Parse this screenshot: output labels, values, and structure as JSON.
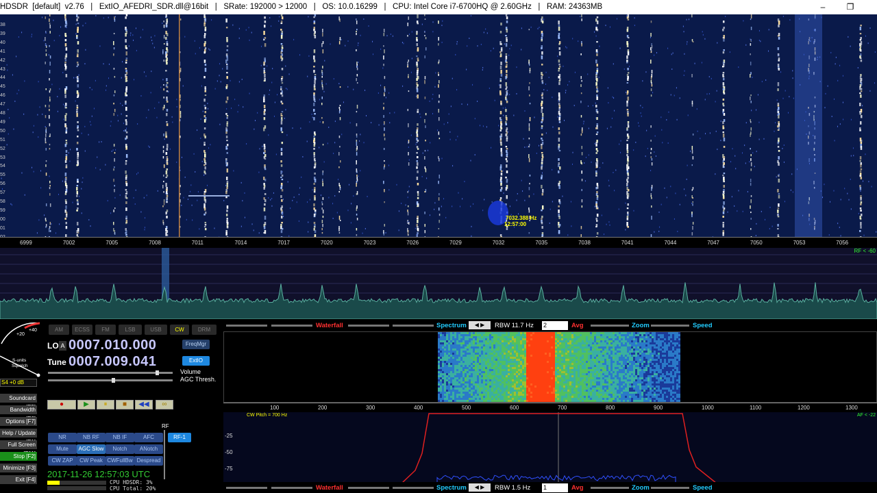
{
  "window": {
    "title": "HDSDR  [default]  v2.76   |   ExtIO_AFEDRI_SDR.dll@16bit   |   SRate: 192000 > 12000   |   OS: 10.0.16299   |   CPU: Intel Core i7-6700HQ @ 2.60GHz   |   RAM: 24363MB",
    "minimize": "–",
    "restore": "❐"
  },
  "waterfall": {
    "y_labels": [
      "38",
      "39",
      "40",
      "41",
      "42",
      "43",
      "44",
      "45",
      "46",
      "47",
      "48",
      "49",
      "50",
      "51",
      "52",
      "53",
      "54",
      "55",
      "56",
      "57",
      "58",
      "59",
      "00",
      "01",
      "02"
    ],
    "freq_ticks": [
      "6999",
      "7002",
      "7005",
      "7008",
      "7011",
      "7014",
      "7017",
      "7020",
      "7023",
      "7026",
      "7029",
      "7032",
      "7035",
      "7038",
      "7041",
      "7044",
      "7047",
      "7050",
      "7053",
      "7056"
    ],
    "cursor_freq": "7032.388 Hz",
    "cursor_time": "12:57:00"
  },
  "spectrum": {
    "rf_label": "RF < -60"
  },
  "modes": [
    {
      "label": "AM",
      "on": false
    },
    {
      "label": "ECSS",
      "on": false
    },
    {
      "label": "FM",
      "on": false
    },
    {
      "label": "LSB",
      "on": false
    },
    {
      "label": "USB",
      "on": false
    },
    {
      "label": "CW",
      "on": true
    },
    {
      "label": "DRM",
      "on": false
    }
  ],
  "meter": {
    "plus40": "+40",
    "plus20": "+20",
    "s_units": "S-units",
    "squelch": "Squelch",
    "reading": "S4 +0 dB"
  },
  "lo": {
    "label": "LO",
    "ab": "A",
    "value": "0007.010.000"
  },
  "tune": {
    "label": "Tune",
    "value": "0007.009.041"
  },
  "buttons": {
    "freqmgr": "FreqMgr",
    "extio": "ExtIO"
  },
  "sliders": {
    "volume": "Volume",
    "agc": "AGC Thresh."
  },
  "side_menu": [
    {
      "label": "Soundcard [F5]",
      "green": false
    },
    {
      "label": "Bandwidth [F6]",
      "green": false
    },
    {
      "label": "Options [F7]",
      "green": false
    },
    {
      "label": "Help / Update [F1]",
      "green": false
    },
    {
      "label": "Full Screen [F11]",
      "green": false
    },
    {
      "label": "Stop [F2]",
      "green": true
    },
    {
      "label": "Minimize [F3]",
      "green": false
    },
    {
      "label": "Exit [F4]",
      "green": false
    }
  ],
  "transport": {
    "record": "●",
    "play": "▶",
    "pause": "⏸",
    "stop": "■",
    "rewind": "◀◀",
    "loop": "∞"
  },
  "pads": [
    [
      "NR",
      "NB RF",
      "NB IF",
      "AFC"
    ],
    [
      "Mute",
      "AGC Slow",
      "Notch",
      "ANotch"
    ],
    [
      "CW ZAP",
      "CW Peak",
      "CWFullBw",
      "Despread"
    ]
  ],
  "rf_label": "RF",
  "rf_button": "RF-1",
  "datetime": "2017-11-26   12:57:03 UTC",
  "cpu": {
    "hdsdr": "CPU HDSDR:  3%",
    "total": "CPU Total: 20%"
  },
  "top_bar": {
    "waterfall": "Waterfall",
    "spectrum": "Spectrum",
    "rbw": "RBW 11.7 Hz",
    "avg_value": "2",
    "avg": "Avg",
    "zoom": "Zoom",
    "speed": "Speed"
  },
  "zoom_scale": [
    "100",
    "200",
    "300",
    "400",
    "500",
    "600",
    "700",
    "800",
    "900",
    "1000",
    "1100",
    "1200",
    "1300"
  ],
  "af": {
    "cw_pitch": "CW Pitch = 700 Hz",
    "af_label": "AF < -22",
    "y_labels": [
      "-25",
      "-50",
      "-75",
      "-100",
      "-125"
    ]
  },
  "bottom_bar": {
    "waterfall": "Waterfall",
    "spectrum": "Spectrum",
    "rbw": "RBW  1.5 Hz",
    "avg_value": "1",
    "avg": "Avg",
    "zoom": "Zoom",
    "speed": "Speed"
  },
  "colors": {
    "accent_red": "#ff3030",
    "accent_cyan": "#22ccff",
    "accent_yellow": "#ffff00",
    "stop_green": "#1a8f1a"
  }
}
